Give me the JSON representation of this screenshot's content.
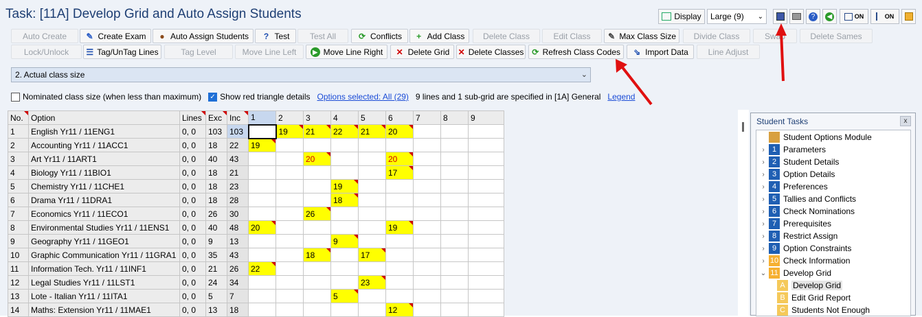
{
  "window": {
    "title": "Task: [11A] Develop Grid and Auto Assign Students"
  },
  "topright": {
    "display_label": "Display",
    "size_value": "Large (9)",
    "on1": "ON",
    "on2": "ON"
  },
  "toolbar1": [
    "Auto Create",
    "Create Exam",
    "Auto Assign Students",
    "Test",
    "Test All",
    "Conflicts",
    "Add Class",
    "Delete Class",
    "Edit Class",
    "Max Class Size",
    "Divide Class",
    "Swap",
    "Delete Sames"
  ],
  "toolbar2": [
    "Lock/Unlock",
    "Tag/UnTag Lines",
    "Tag Level",
    "Move Line Left",
    "Move Line Right",
    "Delete Grid",
    "Delete Classes",
    "Refresh Class Codes",
    "Import Data",
    "Line Adjust"
  ],
  "dropdown": {
    "value": "2.  Actual class size"
  },
  "options": {
    "nominated_label": "Nominated class size (when less than maximum)",
    "show_red_label": "Show red triangle details",
    "options_link": "Options selected: All (29)",
    "info_text": "9 lines and 1 sub-grid are specified in [1A] General",
    "legend_link": "Legend"
  },
  "grid": {
    "headers": [
      "No.",
      "Option",
      "Lines",
      "Exc",
      "Inc",
      "1",
      "2",
      "3",
      "4",
      "5",
      "6",
      "7",
      "8",
      "9"
    ],
    "rows": [
      {
        "no": "1",
        "option": "English Yr11 / 11ENG1",
        "lines": "0, 0",
        "exc": "103",
        "inc": "103",
        "cells": [
          "",
          "19",
          "21",
          "22",
          "21",
          "20",
          "",
          "",
          ""
        ]
      },
      {
        "no": "2",
        "option": "Accounting Yr11 / 11ACC1",
        "lines": "0, 0",
        "exc": "18",
        "inc": "22",
        "cells": [
          "19",
          "",
          "",
          "",
          "",
          "",
          "",
          "",
          ""
        ]
      },
      {
        "no": "3",
        "option": "Art Yr11 / 11ART1",
        "lines": "0, 0",
        "exc": "40",
        "inc": "43",
        "cells": [
          "",
          "",
          "20",
          "",
          "",
          "20",
          "",
          "",
          ""
        ]
      },
      {
        "no": "4",
        "option": "Biology Yr11 / 11BIO1",
        "lines": "0, 0",
        "exc": "18",
        "inc": "21",
        "cells": [
          "",
          "",
          "",
          "",
          "",
          "17",
          "",
          "",
          ""
        ]
      },
      {
        "no": "5",
        "option": "Chemistry Yr11 / 11CHE1",
        "lines": "0, 0",
        "exc": "18",
        "inc": "23",
        "cells": [
          "",
          "",
          "",
          "19",
          "",
          "",
          "",
          "",
          ""
        ]
      },
      {
        "no": "6",
        "option": "Drama Yr11 / 11DRA1",
        "lines": "0, 0",
        "exc": "18",
        "inc": "28",
        "cells": [
          "",
          "",
          "",
          "18",
          "",
          "",
          "",
          "",
          ""
        ]
      },
      {
        "no": "7",
        "option": "Economics Yr11 / 11ECO1",
        "lines": "0, 0",
        "exc": "26",
        "inc": "30",
        "cells": [
          "",
          "",
          "26",
          "",
          "",
          "",
          "",
          "",
          ""
        ]
      },
      {
        "no": "8",
        "option": "Environmental Studies Yr11 / 11ENS1",
        "lines": "0, 0",
        "exc": "40",
        "inc": "48",
        "cells": [
          "20",
          "",
          "",
          "",
          "",
          "19",
          "",
          "",
          ""
        ]
      },
      {
        "no": "9",
        "option": "Geography Yr11 / 11GEO1",
        "lines": "0, 0",
        "exc": "9",
        "inc": "13",
        "cells": [
          "",
          "",
          "",
          "9",
          "",
          "",
          "",
          "",
          ""
        ]
      },
      {
        "no": "10",
        "option": "Graphic Communication Yr11 / 11GRA1",
        "lines": "0, 0",
        "exc": "35",
        "inc": "43",
        "cells": [
          "",
          "",
          "18",
          "",
          "17",
          "",
          "",
          "",
          ""
        ]
      },
      {
        "no": "11",
        "option": "Information Tech. Yr11 / 11INF1",
        "lines": "0, 0",
        "exc": "21",
        "inc": "26",
        "cells": [
          "22",
          "",
          "",
          "",
          "",
          "",
          "",
          "",
          ""
        ]
      },
      {
        "no": "12",
        "option": "Legal Studies Yr11 / 11LST1",
        "lines": "0, 0",
        "exc": "24",
        "inc": "34",
        "cells": [
          "",
          "",
          "",
          "",
          "23",
          "",
          "",
          "",
          ""
        ]
      },
      {
        "no": "13",
        "option": "Lote - Italian Yr11 / 11ITA1",
        "lines": "0, 0",
        "exc": "5",
        "inc": "7",
        "cells": [
          "",
          "",
          "",
          "5",
          "",
          "",
          "",
          "",
          ""
        ]
      },
      {
        "no": "14",
        "option": "Maths: Extension Yr11 / 11MAE1",
        "lines": "0, 0",
        "exc": "13",
        "inc": "18",
        "cells": [
          "",
          "",
          "",
          "",
          "",
          "12",
          "",
          "",
          ""
        ]
      }
    ]
  },
  "panel": {
    "title": "Student Tasks",
    "close": "x",
    "items": [
      {
        "num": "",
        "label": "Student Options Module"
      },
      {
        "num": "1",
        "label": "Parameters"
      },
      {
        "num": "2",
        "label": "Student Details"
      },
      {
        "num": "3",
        "label": "Option Details"
      },
      {
        "num": "4",
        "label": "Preferences"
      },
      {
        "num": "5",
        "label": "Tallies and Conflicts"
      },
      {
        "num": "6",
        "label": "Check Nominations"
      },
      {
        "num": "7",
        "label": "Prerequisites"
      },
      {
        "num": "8",
        "label": "Restrict Assign"
      },
      {
        "num": "9",
        "label": "Option Constraints"
      },
      {
        "num": "10",
        "label": "Check Information"
      },
      {
        "num": "11",
        "label": "Develop Grid"
      },
      {
        "num": "A",
        "label": "Develop Grid"
      },
      {
        "num": "B",
        "label": "Edit Grid Report"
      },
      {
        "num": "C",
        "label": "Students Not Enough"
      }
    ]
  },
  "colors": {
    "accent": "#1e3f74",
    "cell_yellow": "#ffff00",
    "red_text": "#d00000",
    "arrow": "#e01010"
  }
}
